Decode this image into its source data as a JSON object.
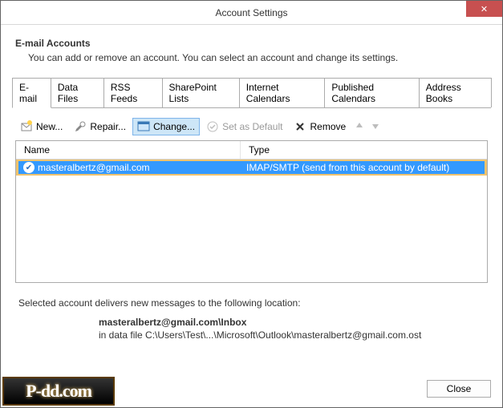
{
  "window": {
    "title": "Account Settings"
  },
  "header": {
    "title": "E-mail Accounts",
    "description": "You can add or remove an account. You can select an account and change its settings."
  },
  "tabs": [
    {
      "label": "E-mail",
      "active": true
    },
    {
      "label": "Data Files"
    },
    {
      "label": "RSS Feeds"
    },
    {
      "label": "SharePoint Lists"
    },
    {
      "label": "Internet Calendars"
    },
    {
      "label": "Published Calendars"
    },
    {
      "label": "Address Books"
    }
  ],
  "toolbar": {
    "new_label": "New...",
    "repair_label": "Repair...",
    "change_label": "Change...",
    "set_default_label": "Set as Default",
    "remove_label": "Remove"
  },
  "table": {
    "columns": {
      "name": "Name",
      "type": "Type"
    },
    "rows": [
      {
        "name": "masteralbertz@gmail.com",
        "type": "IMAP/SMTP (send from this account by default)"
      }
    ]
  },
  "footer": {
    "intro": "Selected account delivers new messages to the following location:",
    "location": "masteralbertz@gmail.com\\Inbox",
    "datafile": "in data file C:\\Users\\Test\\...\\Microsoft\\Outlook\\masteralbertz@gmail.com.ost"
  },
  "buttons": {
    "close": "Close"
  },
  "watermark": "P-dd.com"
}
